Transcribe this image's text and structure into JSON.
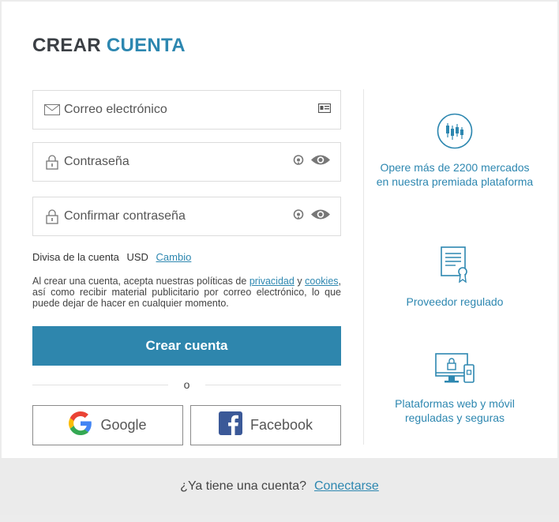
{
  "title": {
    "part1": "CREAR",
    "part2": "CUENTA"
  },
  "form": {
    "email_placeholder": "Correo electrónico",
    "password_placeholder": "Contraseña",
    "confirm_placeholder": "Confirmar contraseña"
  },
  "currency": {
    "label": "Divisa de la cuenta",
    "value": "USD",
    "change_link": "Cambio"
  },
  "terms": {
    "text1": "Al crear una cuenta, acepta nuestras políticas de",
    "privacy_link": "privacidad",
    "text2": "y",
    "cookies_link": "cookies",
    "text3": ", así como recibir material publicitario por correo electrónico, lo que puede dejar de hacer en cualquier momento."
  },
  "submit_label": "Crear cuenta",
  "divider_text": "o",
  "social": {
    "google_label": "Google",
    "facebook_label": "Facebook"
  },
  "features": [
    {
      "icon": "candlestick-chart-icon",
      "text": "Opere más de 2200 mercados en nuestra premiada plataforma"
    },
    {
      "icon": "certificate-icon",
      "text": "Proveedor regulado"
    },
    {
      "icon": "devices-lock-icon",
      "text": "Plataformas web y móvil reguladas y seguras"
    }
  ],
  "footer": {
    "text": "¿Ya tiene una cuenta?",
    "link": "Conectarse"
  },
  "colors": {
    "accent": "#2e86ad",
    "title_dark": "#3b3f44",
    "footer_bg": "#ebebeb"
  }
}
